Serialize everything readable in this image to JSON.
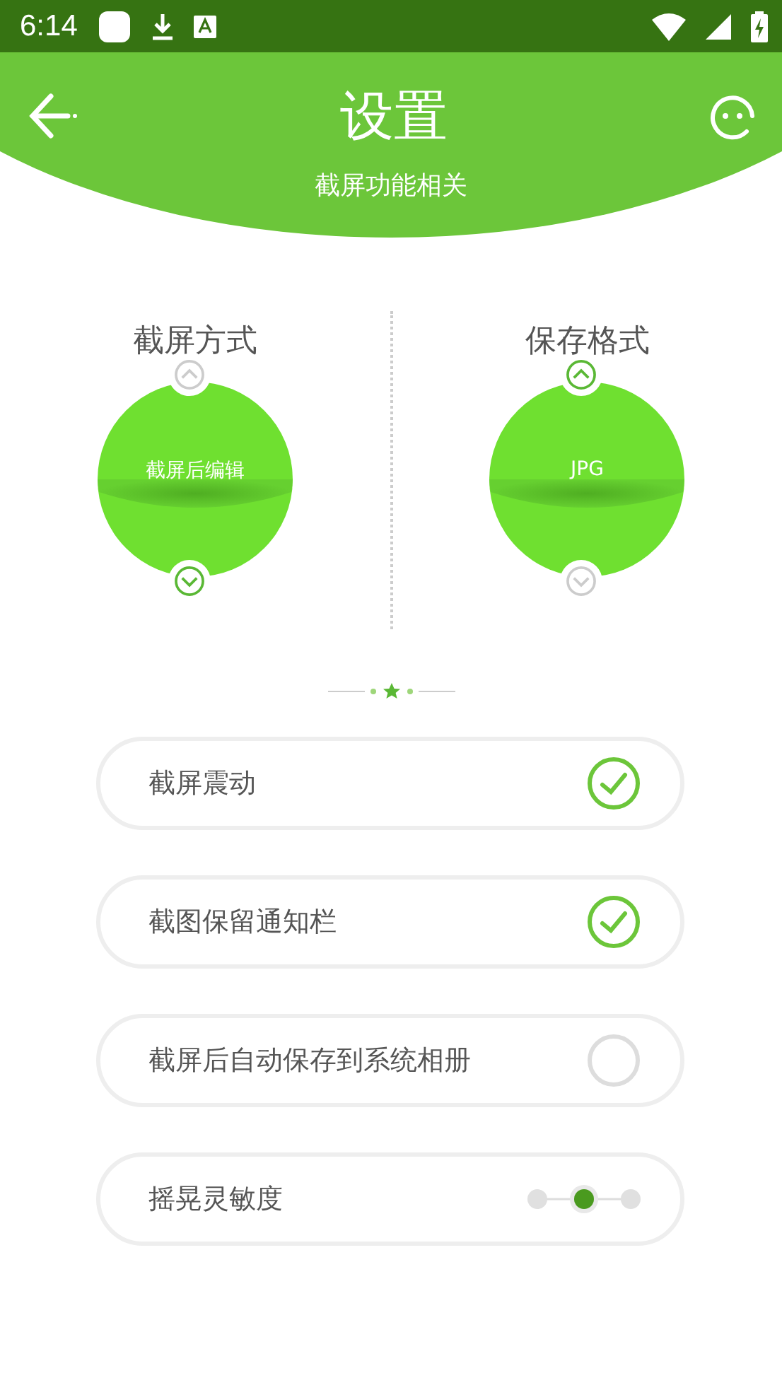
{
  "status_bar": {
    "time": "6:14"
  },
  "header": {
    "title": "设置",
    "subtitle": "截屏功能相关"
  },
  "pickers": [
    {
      "label": "截屏方式",
      "value": "截屏后编辑",
      "up_disabled": true,
      "down_disabled": false
    },
    {
      "label": "保存格式",
      "value": "JPG",
      "up_disabled": false,
      "down_disabled": true
    }
  ],
  "settings": [
    {
      "kind": "check",
      "label": "截屏震动",
      "checked": true
    },
    {
      "kind": "check",
      "label": "截图保留通知栏",
      "checked": true
    },
    {
      "kind": "check",
      "label": "截屏后自动保存到系统相册",
      "checked": false
    },
    {
      "kind": "steps",
      "label": "摇晃灵敏度",
      "level": 0.5
    }
  ]
}
